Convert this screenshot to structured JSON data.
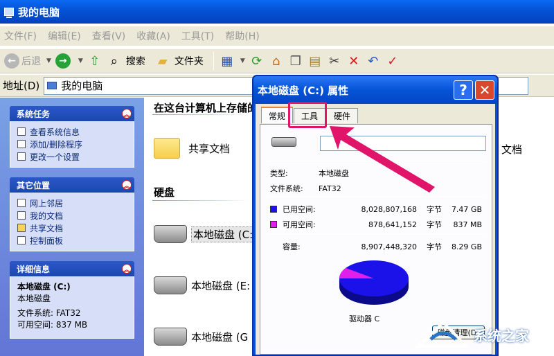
{
  "window": {
    "title": "我的电脑"
  },
  "menu": [
    "文件(F)",
    "编辑(E)",
    "查看(V)",
    "收藏(A)",
    "工具(T)",
    "帮助(H)"
  ],
  "toolbar": {
    "back": "后退",
    "search": "搜索",
    "folders": "文件夹"
  },
  "address": {
    "label": "地址(D)",
    "value": "我的电脑"
  },
  "sidebar": {
    "system_tasks": {
      "title": "系统任务",
      "items": [
        "查看系统信息",
        "添加/删除程序",
        "更改一个设置"
      ]
    },
    "other_places": {
      "title": "其它位置",
      "items": [
        "网上邻居",
        "我的文档",
        "共享文档",
        "控制面板"
      ]
    },
    "details": {
      "title": "详细信息",
      "name": "本地磁盘 (C:)",
      "type": "本地磁盘",
      "fs": "文件系统: FAT32",
      "free": "可用空间: 837 MB"
    }
  },
  "main": {
    "stored_header": "在这台计算机上存储的文件",
    "shared_docs": "共享文档",
    "partial_right": "文档",
    "hdd_header": "硬盘",
    "drives": [
      "本地磁盘 (C:",
      "本地磁盘 (E:",
      "本地磁盘 (G"
    ]
  },
  "dialog": {
    "title": "本地磁盘 (C:) 属性",
    "tabs": [
      "常规",
      "工具",
      "硬件"
    ],
    "name_value": "",
    "type_label": "类型:",
    "type_value": "本地磁盘",
    "fs_label": "文件系统:",
    "fs_value": "FAT32",
    "used_label": "已用空间:",
    "used_bytes": "8,028,807,168",
    "used_unit": "字节",
    "used_size": "7.47 GB",
    "free_label": "可用空间:",
    "free_bytes": "878,641,152",
    "free_unit": "字节",
    "free_size": "837 MB",
    "cap_label": "容量:",
    "cap_bytes": "8,907,448,320",
    "cap_unit": "字节",
    "cap_size": "8.29 GB",
    "drive_caption": "驱动器 C",
    "cleanup": "磁盘清理(D)",
    "used_color": "#1a12e8",
    "free_color": "#e020e8"
  },
  "watermark": "系统之家"
}
